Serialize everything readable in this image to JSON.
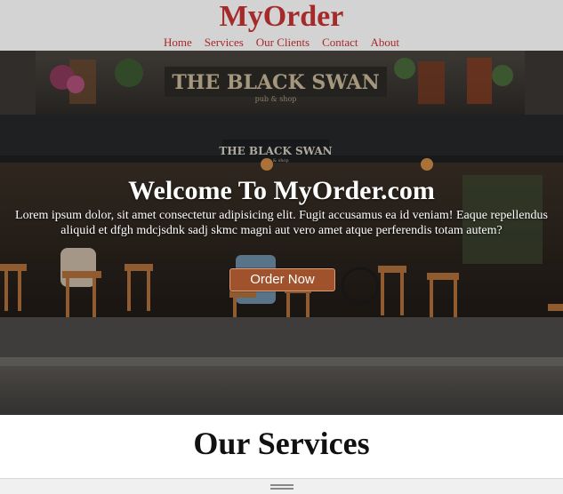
{
  "header": {
    "brand": "MyOrder",
    "nav": [
      "Home",
      "Services",
      "Our Clients",
      "Contact",
      "About"
    ]
  },
  "hero": {
    "sign_main": "THE BLACK SWAN",
    "sign_sub": "pub & shop",
    "awning_main": "THE BLACK SWAN",
    "awning_sub": "pub & shop",
    "title": "Welcome To MyOrder.com",
    "text": "Lorem ipsum dolor, sit amet consectetur adipisicing elit. Fugit accusamus ea id veniam! Eaque repellendus aliquid et dfgh mdcjsdnk sadj skmc magni aut vero amet atque perferendis totam autem?",
    "button": "Order Now"
  },
  "services": {
    "title": "Our Services"
  },
  "colors": {
    "brand": "#a52a2a",
    "header_bg": "#d3d3d3",
    "button_bg": "#a0522d"
  }
}
